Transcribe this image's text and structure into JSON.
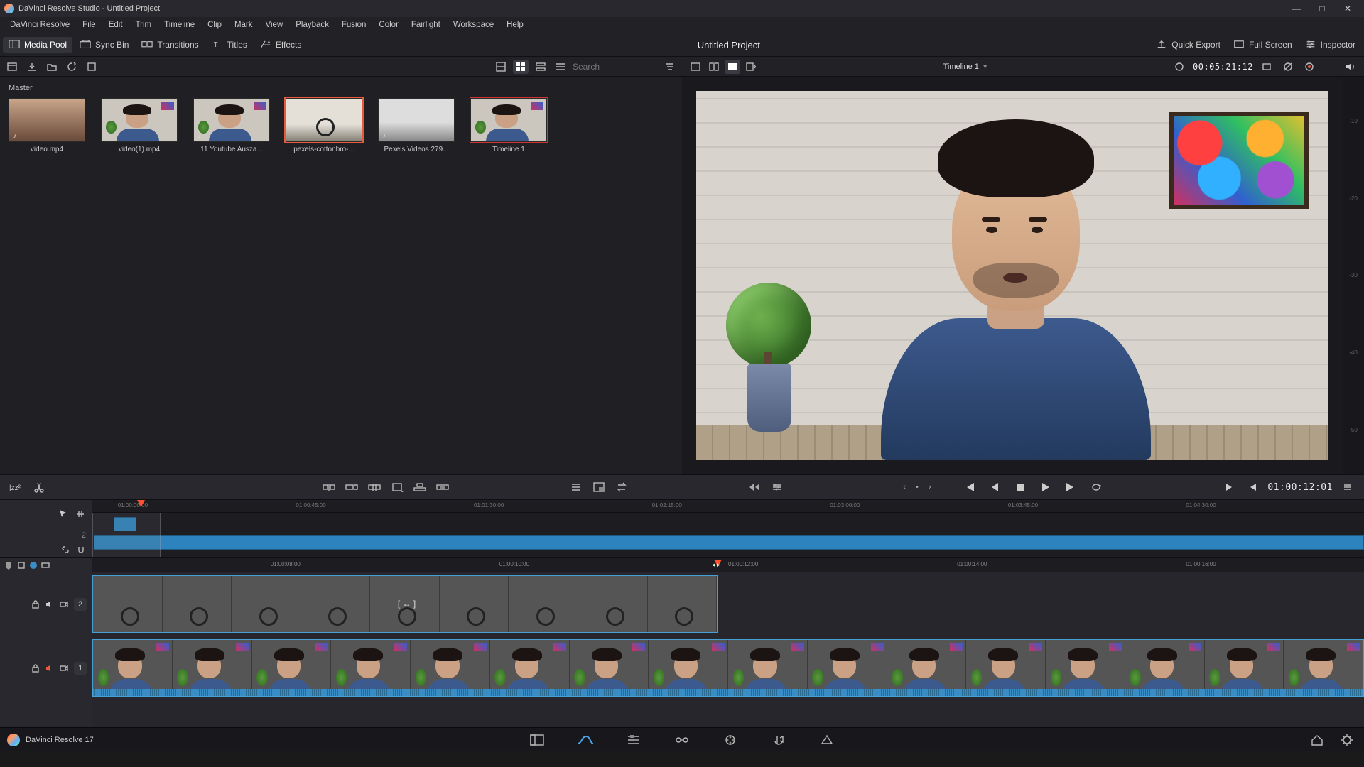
{
  "window": {
    "title": "DaVinci Resolve Studio - Untitled Project"
  },
  "menu": [
    "DaVinci Resolve",
    "File",
    "Edit",
    "Trim",
    "Timeline",
    "Clip",
    "Mark",
    "View",
    "Playback",
    "Fusion",
    "Color",
    "Fairlight",
    "Workspace",
    "Help"
  ],
  "toolbar": {
    "media_pool": "Media Pool",
    "sync_bin": "Sync Bin",
    "transitions": "Transitions",
    "titles": "Titles",
    "effects": "Effects",
    "quick_export": "Quick Export",
    "full_screen": "Full Screen",
    "inspector": "Inspector"
  },
  "project_title": "Untitled Project",
  "search_placeholder": "Search",
  "viewer": {
    "timeline_label": "Timeline 1",
    "source_tc": "00:05:21:12",
    "record_tc": "01:00:12:01"
  },
  "media_pool": {
    "bin": "Master",
    "clips": [
      {
        "name": "video.mp4"
      },
      {
        "name": "video(1).mp4"
      },
      {
        "name": "11 Youtube Ausza..."
      },
      {
        "name": "pexels-cottonbro-..."
      },
      {
        "name": "Pexels Videos 279..."
      },
      {
        "name": "Timeline 1"
      }
    ],
    "selected_index": 3
  },
  "meter_marks": [
    "-10",
    "-20",
    "-30",
    "-40",
    "-50"
  ],
  "overview_ruler": [
    {
      "pos": 2,
      "label": "01:00:00:00"
    },
    {
      "pos": 16,
      "label": "01:00:45:00"
    },
    {
      "pos": 30,
      "label": "01:01:30:00"
    },
    {
      "pos": 44,
      "label": "01:02:15:00"
    },
    {
      "pos": 58,
      "label": "01:03:00:00"
    },
    {
      "pos": 72,
      "label": "01:03:45:00"
    },
    {
      "pos": 86,
      "label": "01:04:30:00"
    }
  ],
  "main_ruler": [
    {
      "pos": 14,
      "label": "01:00:08:00"
    },
    {
      "pos": 32,
      "label": "01:00:10:00"
    },
    {
      "pos": 50,
      "label": "01:00:12:00"
    },
    {
      "pos": 68,
      "label": "01:00:14:00"
    },
    {
      "pos": 86,
      "label": "01:00:16:00"
    }
  ],
  "tracks": {
    "v2_label": "2",
    "v1_label": "1"
  },
  "bottom": {
    "app_version": "DaVinci Resolve 17"
  },
  "colors": {
    "accent": "#e85a3a",
    "clip_blue": "#2d83bd",
    "playhead": "#ff5030"
  }
}
